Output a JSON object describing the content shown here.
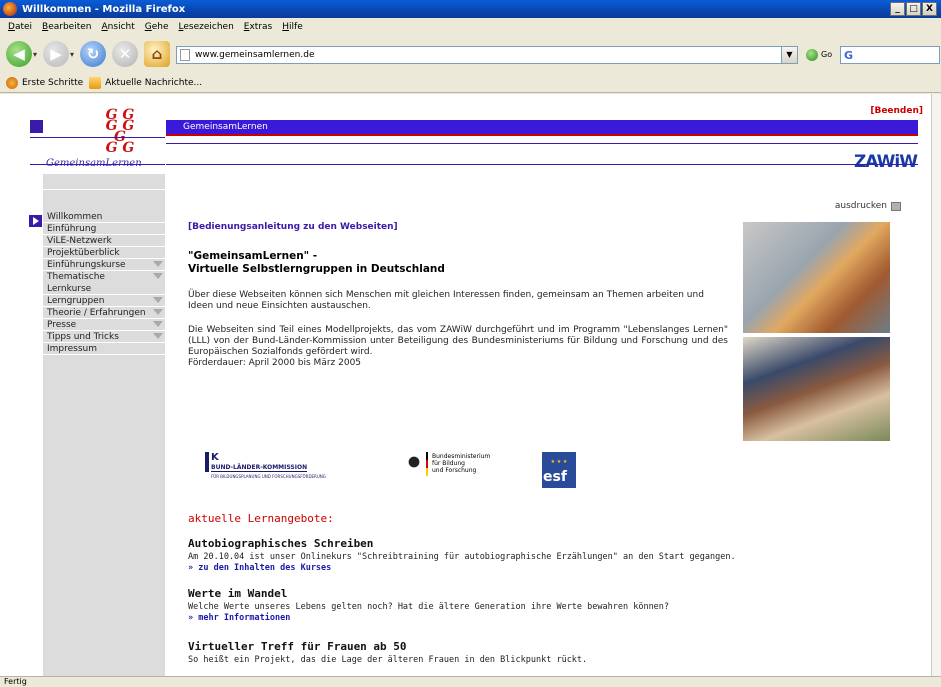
{
  "browser": {
    "window_title": "Willkommen - Mozilla Firefox",
    "menu": [
      "Datei",
      "Bearbeiten",
      "Ansicht",
      "Gehe",
      "Lesezeichen",
      "Extras",
      "Hilfe"
    ],
    "url": "www.gemeinsamlernen.de",
    "go_label": "Go",
    "search_engine_glyph": "G",
    "bookmarks": [
      "Erste Schritte",
      "Aktuelle Nachrichte..."
    ],
    "status_text": "Fertig",
    "window_controls": [
      "_",
      "□",
      "X"
    ]
  },
  "header": {
    "logo_letters": "GG\nGGG\nGG",
    "logo_name": "GemeinsamLernen",
    "bar_title": "GemeinsamLernen",
    "exit_link": "[Beenden]",
    "partner_logo": "ZAWiW"
  },
  "sidebar": {
    "items": [
      {
        "label": "Willkommen",
        "submenu": false,
        "active": true
      },
      {
        "label": "Einführung",
        "submenu": false
      },
      {
        "label": "ViLE-Netzwerk",
        "submenu": false
      },
      {
        "label": "Projektüberblick",
        "submenu": false
      },
      {
        "label": "Einführungskurse",
        "submenu": true
      },
      {
        "label": "Thematische Lernkurse",
        "submenu": true
      },
      {
        "label": "Lerngruppen",
        "submenu": true
      },
      {
        "label": "Theorie / Erfahrungen",
        "submenu": true
      },
      {
        "label": "Presse",
        "submenu": true
      },
      {
        "label": "Tipps und Tricks",
        "submenu": true
      },
      {
        "label": "Impressum",
        "submenu": false
      }
    ]
  },
  "main": {
    "print_label": "ausdrucken",
    "manual_link": "[Bedienungsanleitung zu den Webseiten]",
    "headline_line1": "\"GemeinsamLernen\" -",
    "headline_line2": "Virtuelle Selbstlerngruppen in Deutschland",
    "intro": "Über diese Webseiten können sich Menschen mit gleichen Interessen finden, gemeinsam an Themen arbeiten und Ideen und neue Einsichten austauschen.",
    "project": "Die Webseiten sind Teil eines Modellprojekts, das vom ZAWiW durchgeführt und im Programm \"Lebenslanges Lernen\" (LLL) von der Bund-Länder-Kommission unter Beteiligung des Bundesministeriums für Bildung und Forschung und des Europäischen Sozialfonds gefördert wird.",
    "duration": "Förderdauer: April 2000 bis März 2005",
    "sponsors": {
      "blk_letter": "K",
      "blk_name": "BUND-LÄNDER-KOMMISSION",
      "blk_sub": "FÜR BILDUNGSPLANUNG UND FORSCHUNGSFÖRDERUNG",
      "bmbf": "Bundesministerium\nfür Bildung\nund Forschung",
      "esf": "esf"
    },
    "offers_title": "aktuelle Lernangebote:",
    "offers": [
      {
        "title": "Autobiographisches Schreiben",
        "text": "Am 20.10.04 ist unser Onlinekurs \"Schreibtraining für autobiographische Erzählungen\" an den Start gegangen.",
        "link": "» zu den Inhalten des Kurses"
      },
      {
        "title": "Werte im Wandel",
        "text": "Welche Werte unseres Lebens gelten noch? Hat die ältere Generation ihre Werte bewahren können?",
        "link": "» mehr Informationen"
      },
      {
        "title": "Virtueller Treff für Frauen ab 50",
        "text": "So heißt ein Projekt, das die Lage der älteren Frauen in den Blickpunkt rückt.",
        "link": ""
      }
    ]
  },
  "colors": {
    "brand_purple": "#3a1ad8",
    "accent_red": "#cc0000",
    "link_blue": "#1a1aa8",
    "sidebar_gray": "#dcdcdc"
  }
}
